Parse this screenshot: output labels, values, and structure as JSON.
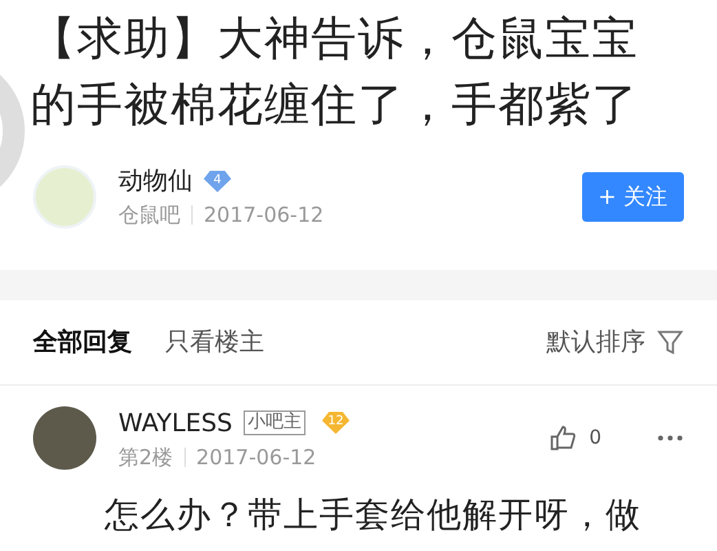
{
  "post": {
    "title": "【求助】大神告诉，仓鼠宝宝的手被棉花缠住了，手都紫了",
    "author": {
      "name": "动物仙",
      "level": "4",
      "forum": "仓鼠吧",
      "date": "2017-06-12",
      "follow_button": "+ 关注"
    }
  },
  "tabs": [
    {
      "label": "全部回复",
      "selected": true
    },
    {
      "label": "只看楼主",
      "selected": false
    }
  ],
  "sort": {
    "label": "默认排序"
  },
  "replies": [
    {
      "name": "WAYLESS",
      "role": "小吧主",
      "level": "12",
      "floor": "第2楼",
      "date": "2017-06-12",
      "likes": "0",
      "text": "怎么办？带上手套给他解开呀，做"
    }
  ]
}
